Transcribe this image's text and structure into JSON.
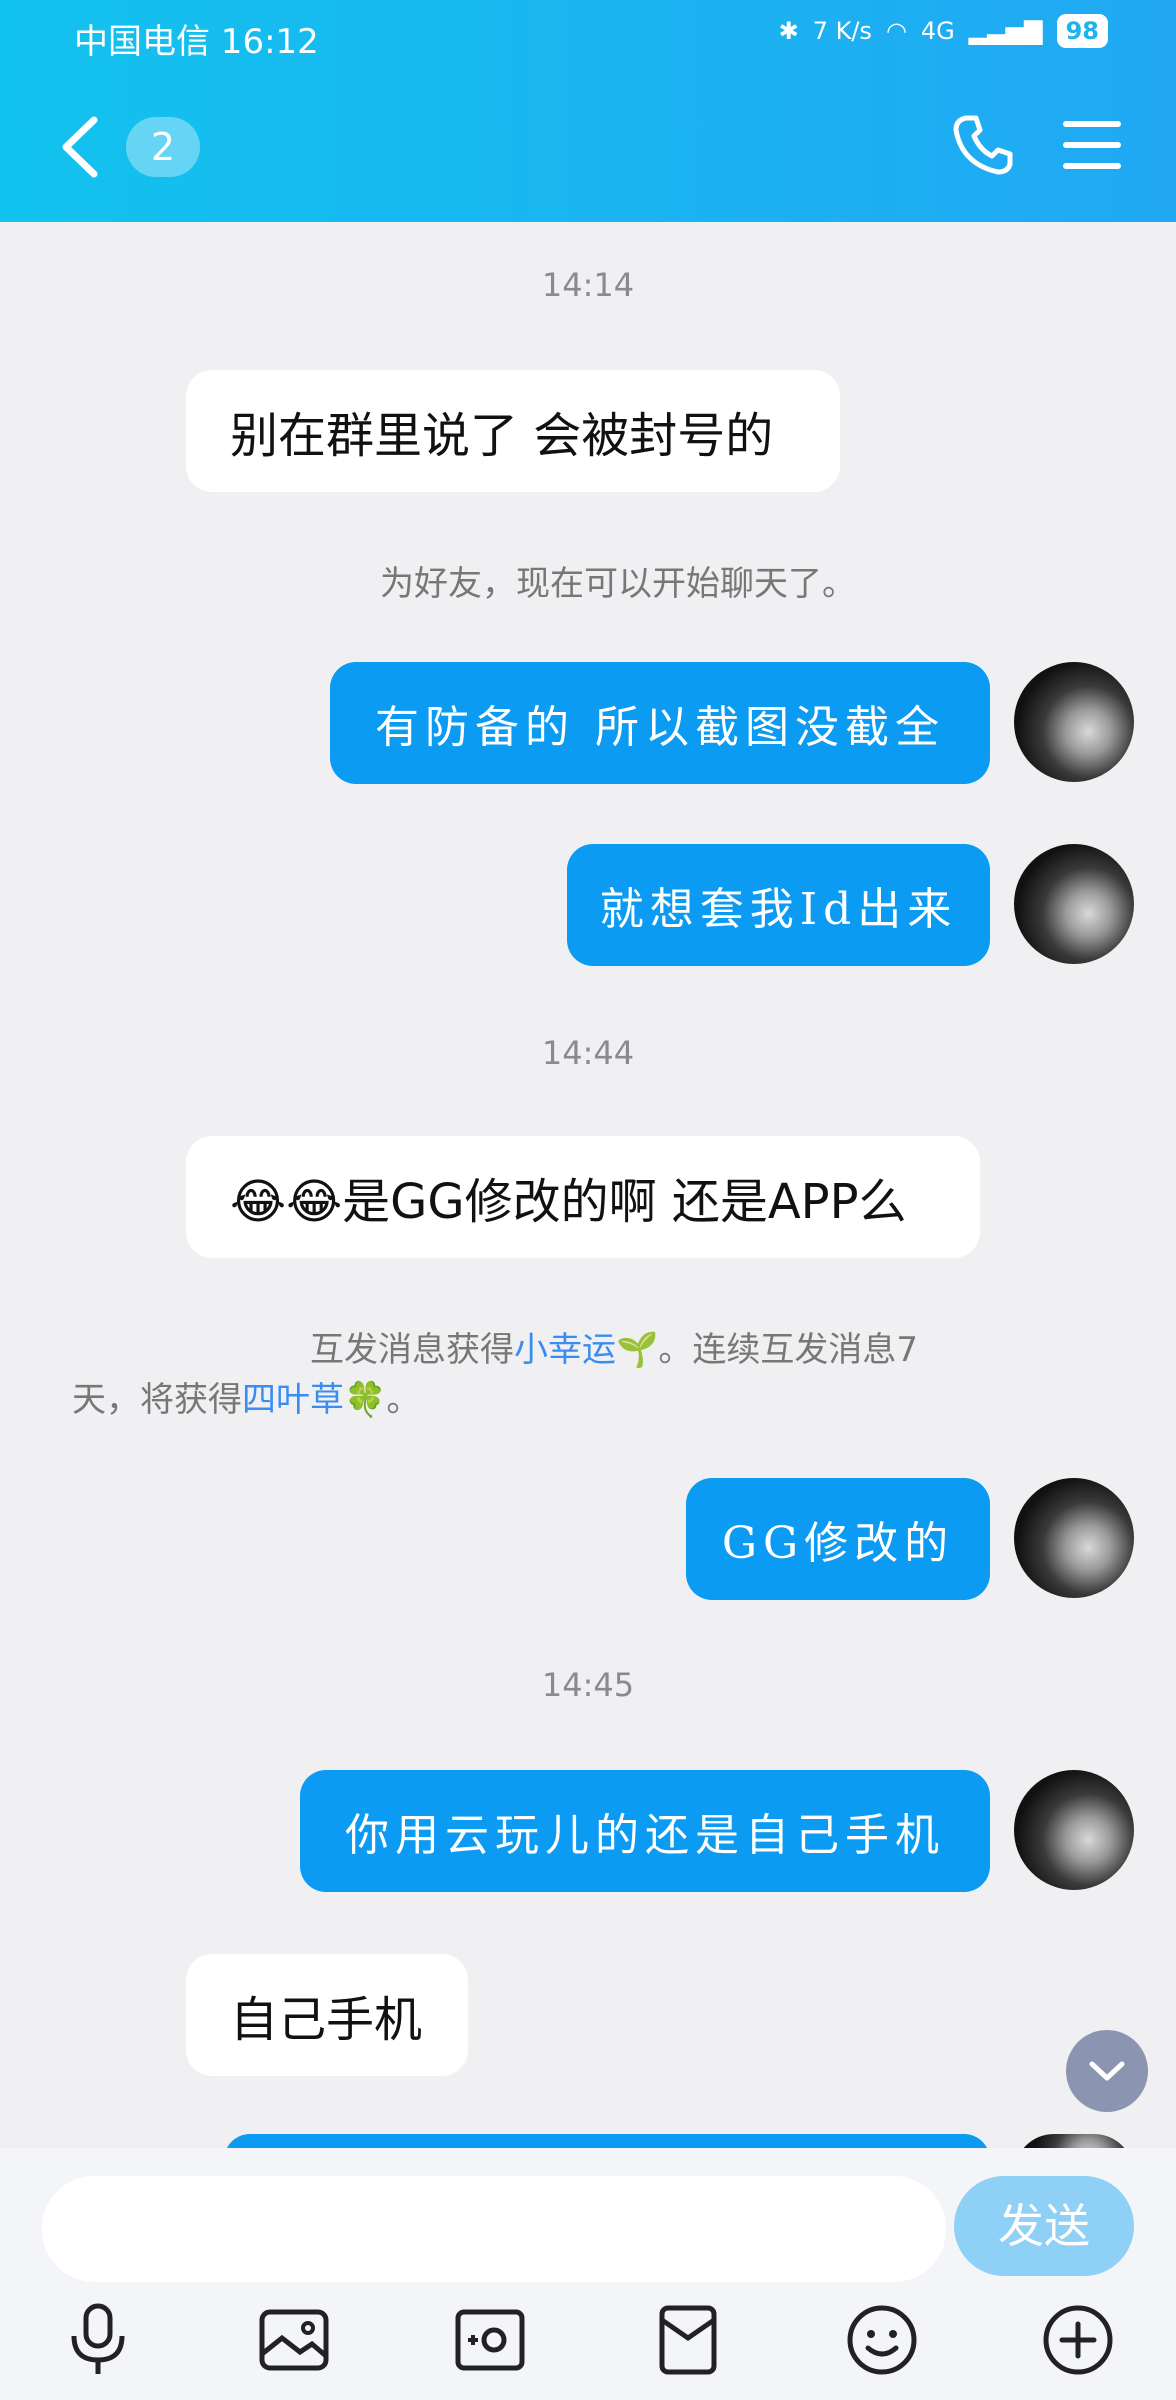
{
  "status_bar": {
    "carrier_time": "中国电信 16:12",
    "net_speed": "7 K/s",
    "signal": "4G",
    "battery": "98"
  },
  "header": {
    "unread_count": "2"
  },
  "messages": {
    "t1": "14:14",
    "m1": "别在群里说了 会被封号的",
    "s1": "为好友，现在可以开始聊天了。",
    "m2": "有防备的 所以截图没截全",
    "m3": "就想套我Id出来",
    "t2": "14:44",
    "m4": "😂😂是GG修改的啊  还是APP么",
    "s2_a": "互发消息获得",
    "s2_link1": "小幸运",
    "s2_b": "。连续互发消息7",
    "s2_c": "天，将获得",
    "s2_link2": "四叶草",
    "s2_d": "。",
    "m5": "GG修改的",
    "t3": "14:45",
    "m6": "你用云玩儿的还是自己手机",
    "m7": "自己手机"
  },
  "input": {
    "send_label": "发送"
  },
  "colors": {
    "header": "#1db3f0",
    "outgoing_bubble": "#0b9bf3",
    "send_button": "#8fd1f6"
  }
}
